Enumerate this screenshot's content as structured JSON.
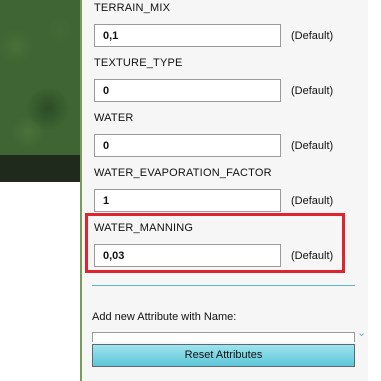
{
  "attributes": [
    {
      "name": "TERRAIN_MIX",
      "value": "0,1",
      "default_label": "(Default)"
    },
    {
      "name": "TEXTURE_TYPE",
      "value": "0",
      "default_label": "(Default)"
    },
    {
      "name": "WATER",
      "value": "0",
      "default_label": "(Default)"
    },
    {
      "name": "WATER_EVAPORATION_FACTOR",
      "value": "1",
      "default_label": "(Default)"
    },
    {
      "name": "WATER_MANNING",
      "value": "0,03",
      "default_label": "(Default)"
    }
  ],
  "new_attribute": {
    "label": "Add new Attribute with Name:",
    "value": ""
  },
  "reset_button_label": "Reset Attributes",
  "colors": {
    "highlight": "#e0242f",
    "button": "#5cc7d8",
    "divider": "#5fb6c4"
  }
}
